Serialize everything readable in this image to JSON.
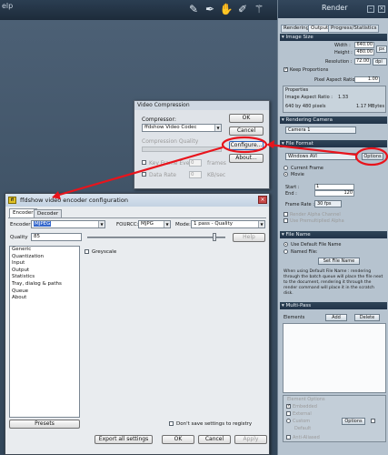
{
  "top_bar": {
    "menu_fragment": "elp"
  },
  "render_panel": {
    "title": "Render",
    "tabs": [
      "Rendering",
      "Output",
      "Progress/Statistics"
    ],
    "active_tab": "Output",
    "image_size": {
      "header": "Image Size",
      "width_label": "Width :",
      "width_value": "640.00",
      "height_label": "Height :",
      "height_value": "480.00",
      "unit": "px",
      "resolution_label": "Resolution :",
      "resolution_value": "72.00",
      "resolution_unit": "dpi",
      "keep_proportions": "Keep Proportions",
      "pixel_aspect_label": "Pixel Aspect Ratio :",
      "pixel_aspect_value": "1.00",
      "properties_title": "Properties",
      "image_aspect_label": "Image Aspect Ratio :",
      "image_aspect_value": "1.33",
      "pixels_text": "640 by 480 pixels",
      "size_text": "1.17 MBytes"
    },
    "rendering_camera": {
      "header": "Rendering Camera",
      "camera": "Camera 1"
    },
    "file_format": {
      "header": "File Format",
      "format": "Windows AVI",
      "options_button": "Options",
      "current_frame": "Current Frame",
      "movie": "Movie",
      "start_label": "Start :",
      "start_value": "1",
      "end_label": "End :",
      "end_value": "120",
      "frame_rate_label": "Frame Rate :",
      "frame_rate_value": "30 fps",
      "render_alpha": "Render Alpha Channel",
      "premultiplied": "Use Premultiplied Alpha"
    },
    "file_name": {
      "header": "File Name",
      "use_default": "Use Default File Name",
      "named_file": "Named File:",
      "set_button": "Set File Name",
      "description": [
        "When using Default File Name : rendering",
        "through the batch queue will place the file next",
        "to the document, rendering it through the",
        "render command will place it in the scratch",
        "disk."
      ]
    },
    "multi_pass": {
      "header": "Multi-Pass",
      "elements_label": "Elements",
      "add_button": "Add",
      "delete_button": "Delete",
      "element_options_title": "Element Options",
      "embedded": "Embedded",
      "external": "External",
      "custom": "Custom",
      "options_button": "Options",
      "default": "Default",
      "anti_aliased": "Anti-Aliased"
    }
  },
  "video_compression": {
    "title": "Video Compression",
    "compressor_label": "Compressor:",
    "compressor_value": "ffdshow Video Codec",
    "quality_label": "Compression Quality",
    "key_frame_label": "Key Frame Every",
    "key_frame_value": "0",
    "key_frame_unit": "frames",
    "data_rate_label": "Data Rate",
    "data_rate_value": "0",
    "data_rate_unit": "KB/sec",
    "ok_button": "OK",
    "cancel_button": "Cancel",
    "configure_button": "Configure...",
    "about_button": "About..."
  },
  "ffdshow": {
    "title": "ffdshow video encoder configuration",
    "tabs": [
      "Encoder",
      "Decoder"
    ],
    "encoder_label": "Encoder:",
    "encoder_value": "MJPEG",
    "fourcc_label": "FOURCC:",
    "fourcc_value": "MJPG",
    "mode_label": "Mode:",
    "mode_value": "1 pass - Quality",
    "quality_label": "Quality",
    "quality_value": "85",
    "help_button": "Help",
    "list_items": [
      "Generic",
      "Quantization",
      "Input",
      "Output",
      "Statistics",
      "Tray, dialog & paths",
      "Queue",
      "About"
    ],
    "greyscale_label": "Greyscale",
    "presets_button": "Presets",
    "dont_save_label": "Don't save settings to registry",
    "export_button": "Export all settings",
    "ok_button": "OK",
    "cancel_button": "Cancel",
    "apply_button": "Apply"
  },
  "colors": {
    "annotation": "#e8141c",
    "title_bar": "#24364a",
    "panel_bg": "#b6c3cf"
  }
}
